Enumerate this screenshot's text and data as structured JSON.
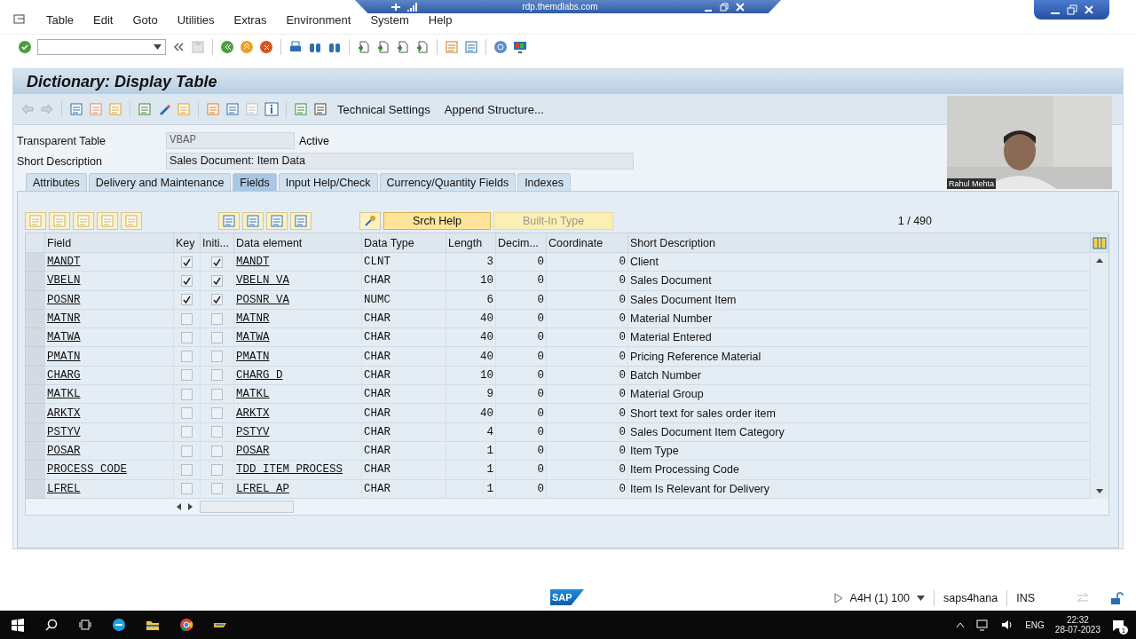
{
  "remote_bar": {
    "title": "rdp.themdlabs.com"
  },
  "menu": [
    "Table",
    "Edit",
    "Goto",
    "Utilities",
    "Extras",
    "Environment",
    "System",
    "Help"
  ],
  "screen_title": "Dictionary: Display Table",
  "app_toolbar": [
    "Technical Settings",
    "Append Structure..."
  ],
  "form": {
    "table_label": "Transparent Table",
    "table_value": "VBAP",
    "table_status": "Active",
    "description_label": "Short Description",
    "description_value": "Sales Document: Item Data"
  },
  "tabs": [
    {
      "label": "Attributes",
      "selected": false
    },
    {
      "label": "Delivery and Maintenance",
      "selected": false
    },
    {
      "label": "Fields",
      "selected": true
    },
    {
      "label": "Input Help/Check",
      "selected": false
    },
    {
      "label": "Currency/Quantity Fields",
      "selected": false
    },
    {
      "label": "Indexes",
      "selected": false
    }
  ],
  "grid_buttons": [
    {
      "label": "Srch Help",
      "disabled": false
    },
    {
      "label": "Built-In Type",
      "disabled": true
    }
  ],
  "counter": "1 / 490",
  "table": {
    "columns": [
      "Field",
      "Key",
      "Initi...",
      "Data element",
      "Data Type",
      "Length",
      "Decim...",
      "Coordinate",
      "Short Description"
    ],
    "rows": [
      {
        "field": "MANDT",
        "key": true,
        "initial": true,
        "data_element": "MANDT",
        "data_type": "CLNT",
        "length": "3",
        "decimals": "0",
        "coordinate": "0",
        "description": "Client"
      },
      {
        "field": "VBELN",
        "key": true,
        "initial": true,
        "data_element": "VBELN_VA",
        "data_type": "CHAR",
        "length": "10",
        "decimals": "0",
        "coordinate": "0",
        "description": "Sales Document"
      },
      {
        "field": "POSNR",
        "key": true,
        "initial": true,
        "data_element": "POSNR_VA",
        "data_type": "NUMC",
        "length": "6",
        "decimals": "0",
        "coordinate": "0",
        "description": "Sales Document Item"
      },
      {
        "field": "MATNR",
        "key": false,
        "initial": false,
        "data_element": "MATNR",
        "data_type": "CHAR",
        "length": "40",
        "decimals": "0",
        "coordinate": "0",
        "description": "Material Number"
      },
      {
        "field": "MATWA",
        "key": false,
        "initial": false,
        "data_element": "MATWA",
        "data_type": "CHAR",
        "length": "40",
        "decimals": "0",
        "coordinate": "0",
        "description": "Material Entered"
      },
      {
        "field": "PMATN",
        "key": false,
        "initial": false,
        "data_element": "PMATN",
        "data_type": "CHAR",
        "length": "40",
        "decimals": "0",
        "coordinate": "0",
        "description": "Pricing Reference Material"
      },
      {
        "field": "CHARG",
        "key": false,
        "initial": false,
        "data_element": "CHARG_D",
        "data_type": "CHAR",
        "length": "10",
        "decimals": "0",
        "coordinate": "0",
        "description": "Batch Number"
      },
      {
        "field": "MATKL",
        "key": false,
        "initial": false,
        "data_element": "MATKL",
        "data_type": "CHAR",
        "length": "9",
        "decimals": "0",
        "coordinate": "0",
        "description": "Material Group"
      },
      {
        "field": "ARKTX",
        "key": false,
        "initial": false,
        "data_element": "ARKTX",
        "data_type": "CHAR",
        "length": "40",
        "decimals": "0",
        "coordinate": "0",
        "description": "Short text for sales order item"
      },
      {
        "field": "PSTYV",
        "key": false,
        "initial": false,
        "data_element": "PSTYV",
        "data_type": "CHAR",
        "length": "4",
        "decimals": "0",
        "coordinate": "0",
        "description": "Sales Document Item Category"
      },
      {
        "field": "POSAR",
        "key": false,
        "initial": false,
        "data_element": "POSAR",
        "data_type": "CHAR",
        "length": "1",
        "decimals": "0",
        "coordinate": "0",
        "description": "Item Type"
      },
      {
        "field": "PROCESS_CODE",
        "key": false,
        "initial": false,
        "data_element": "TDD_ITEM_PROCESS",
        "data_type": "CHAR",
        "length": "1",
        "decimals": "0",
        "coordinate": "0",
        "description": "Item Processing Code"
      },
      {
        "field": "LFREL",
        "key": false,
        "initial": false,
        "data_element": "LFREL_AP",
        "data_type": "CHAR",
        "length": "1",
        "decimals": "0",
        "coordinate": "0",
        "description": "Item Is Relevant for Delivery"
      }
    ]
  },
  "webcam": {
    "kind": "picture",
    "name": "Rahul Mehta"
  },
  "status_bar": {
    "logo": "SAP",
    "system": "A4H (1) 100",
    "server": "saps4hana",
    "mode": "INS"
  },
  "taskbar": {
    "language": "ENG",
    "time": "22:32",
    "date": "28-07-2023",
    "notifications": "1"
  }
}
